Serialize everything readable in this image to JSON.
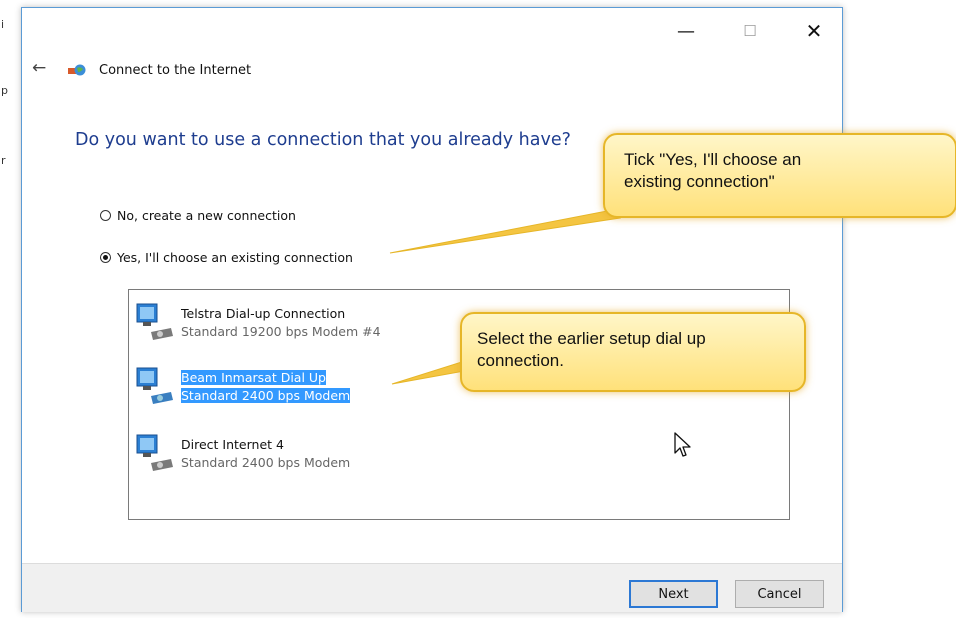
{
  "edge_marks": [
    "i",
    "p",
    "r"
  ],
  "window": {
    "title": "Connect to the Internet",
    "controls": {
      "minimize": "—",
      "maximize": "☐",
      "close": "✕"
    },
    "back_glyph": "←"
  },
  "heading": "Do you want to use a connection that you already have?",
  "options": [
    {
      "label": "No, create a new connection",
      "checked": false
    },
    {
      "label": "Yes, I'll choose an existing connection",
      "checked": true
    }
  ],
  "connections": [
    {
      "name": "Telstra Dial-up Connection",
      "desc": "Standard 19200 bps Modem #4",
      "selected": false
    },
    {
      "name": "Beam Inmarsat Dial Up",
      "desc": "Standard  2400 bps Modem",
      "selected": true
    },
    {
      "name": "Direct Internet 4",
      "desc": "Standard  2400 bps Modem",
      "selected": false
    }
  ],
  "buttons": {
    "next": "Next",
    "cancel": "Cancel"
  },
  "callouts": [
    {
      "line1": "Tick \"Yes, I'll choose an",
      "line2": "existing connection\""
    },
    {
      "line1": "Select the earlier setup dial up",
      "line2": "connection."
    }
  ],
  "colors": {
    "heading": "#1e3d8f",
    "selection": "#3399ff",
    "callout_border": "#e6b628",
    "window_border": "#5b9bd5"
  }
}
